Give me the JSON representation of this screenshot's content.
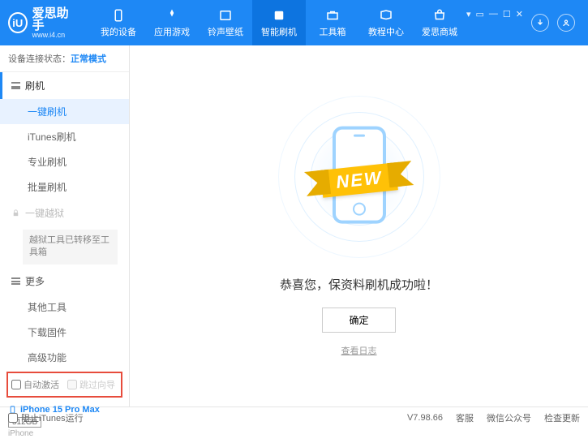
{
  "brand": {
    "name": "爱思助手",
    "url": "www.i4.cn",
    "logo_letter": "iU"
  },
  "nav": [
    {
      "label": "我的设备"
    },
    {
      "label": "应用游戏"
    },
    {
      "label": "铃声壁纸"
    },
    {
      "label": "智能刷机"
    },
    {
      "label": "工具箱"
    },
    {
      "label": "教程中心"
    },
    {
      "label": "爱思商城"
    }
  ],
  "status": {
    "label": "设备连接状态：",
    "value": "正常模式"
  },
  "sidebar": {
    "flash_header": "刷机",
    "items_flash": [
      "一键刷机",
      "iTunes刷机",
      "专业刷机",
      "批量刷机"
    ],
    "jailbreak_header": "一键越狱",
    "jailbreak_note": "越狱工具已转移至工具箱",
    "more_header": "更多",
    "items_more": [
      "其他工具",
      "下载固件",
      "高级功能"
    ],
    "checks": {
      "auto_activate": "自动激活",
      "skip_guide": "跳过向导"
    }
  },
  "device": {
    "name": "iPhone 15 Pro Max",
    "storage": "512GB",
    "type": "iPhone"
  },
  "main": {
    "ribbon": "NEW",
    "message": "恭喜您，保资料刷机成功啦！",
    "ok": "确定",
    "log_link": "查看日志"
  },
  "footer": {
    "block_itunes": "阻止iTunes运行",
    "version": "V7.98.66",
    "links": [
      "客服",
      "微信公众号",
      "检查更新"
    ]
  }
}
